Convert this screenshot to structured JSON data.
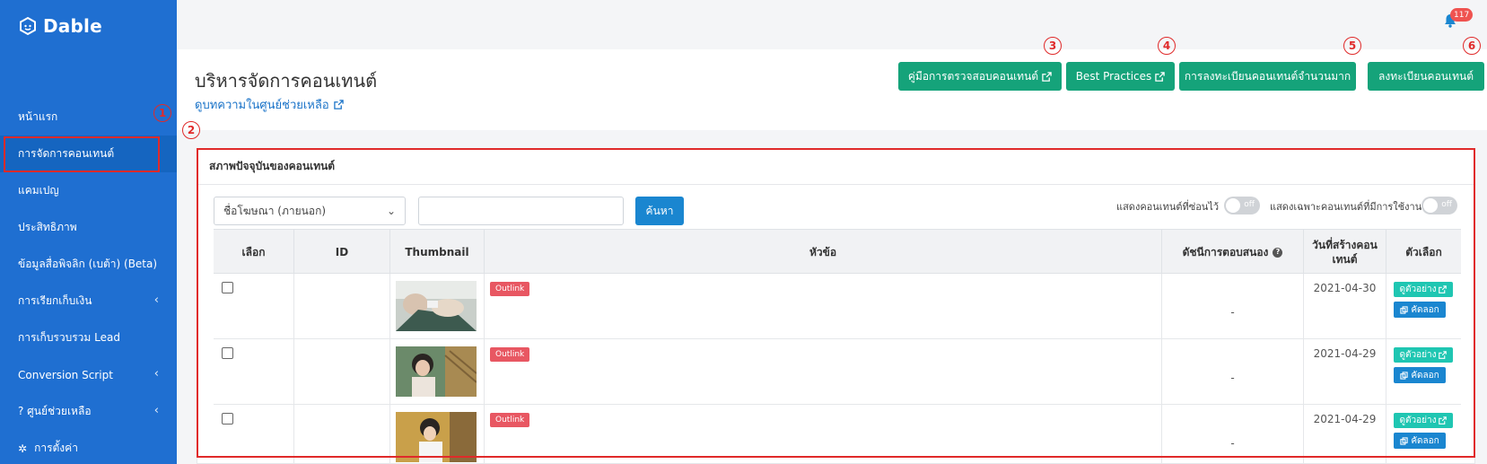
{
  "brand": {
    "name": "Dable",
    "logo_icon": "dable-cube-icon"
  },
  "sidebar": {
    "items": [
      {
        "label": "หน้าแรก",
        "chevron": false
      },
      {
        "label": "การจัดการคอนเทนต์",
        "chevron": false,
        "active": true
      },
      {
        "label": "แคมเปญ",
        "chevron": false
      },
      {
        "label": "ประสิทธิภาพ",
        "chevron": false
      },
      {
        "label": "ข้อมูลสื่อพิจลิก (เบต้า) (Beta)",
        "chevron": false
      },
      {
        "label": "การเรียกเก็บเงิน",
        "chevron": true
      },
      {
        "label": "การเก็บรวบรวม Lead",
        "chevron": false
      },
      {
        "label": "Conversion Script",
        "chevron": true
      },
      {
        "label": "?  ศูนย์ช่วยเหลือ",
        "chevron": true
      },
      {
        "label": "การตั้งค่า",
        "chevron": false,
        "icon": "gear-icon"
      }
    ]
  },
  "notifications": {
    "count": "117"
  },
  "header": {
    "title": "บริหารจัดการคอนเทนต์",
    "help_link": "ดูบทความในศูนย์ช่วยเหลือ",
    "buttons": {
      "guide": "คู่มือการตรวจสอบคอนเทนต์",
      "best_practices": "Best Practices",
      "bulk_register": "การลงทะเบียนคอนเทนต์จำนวนมาก",
      "register": "ลงทะเบียนคอนเทนต์"
    }
  },
  "annotations": {
    "n1": "1",
    "n2": "2",
    "n3": "3",
    "n4": "4",
    "n5": "5",
    "n6": "6"
  },
  "panel": {
    "title": "สภาพปัจจุบันของคอนเทนต์",
    "filter_select": "ชื่อโฆษณา (ภายนอก)",
    "search_value": "",
    "search_button": "ค้นหา",
    "toggle_hidden_label": "แสดงคอนเทนต์ที่ซ่อนไว้",
    "toggle_active_label": "แสดงเฉพาะคอนเทนต์ที่มีการใช้งาน",
    "toggle_off": "off"
  },
  "table": {
    "headers": {
      "select": "เลือก",
      "id": "ID",
      "thumbnail": "Thumbnail",
      "title": "หัวข้อ",
      "response_index": "ดัชนีการตอบสนอง",
      "created_date": "วันที่สร้างคอนเทนต์",
      "options": "ตัวเลือก"
    },
    "rows": [
      {
        "id": "",
        "badge": "Outlink",
        "response": "-",
        "date": "2021-04-30",
        "preview": "ดูตัวอย่าง",
        "copy": "คัดลอก"
      },
      {
        "id": "",
        "badge": "Outlink",
        "response": "-",
        "date": "2021-04-29",
        "preview": "ดูตัวอย่าง",
        "copy": "คัดลอก"
      },
      {
        "id": "",
        "badge": "Outlink",
        "response": "-",
        "date": "2021-04-29",
        "preview": "ดูตัวอย่าง",
        "copy": "คัดลอก"
      }
    ]
  },
  "colors": {
    "sidebar": "#1f6fd1",
    "green": "#15a37a",
    "blue": "#1a86d0",
    "teal": "#1fc6b2",
    "outlink": "#e85762",
    "annotation": "#e02a2a"
  }
}
